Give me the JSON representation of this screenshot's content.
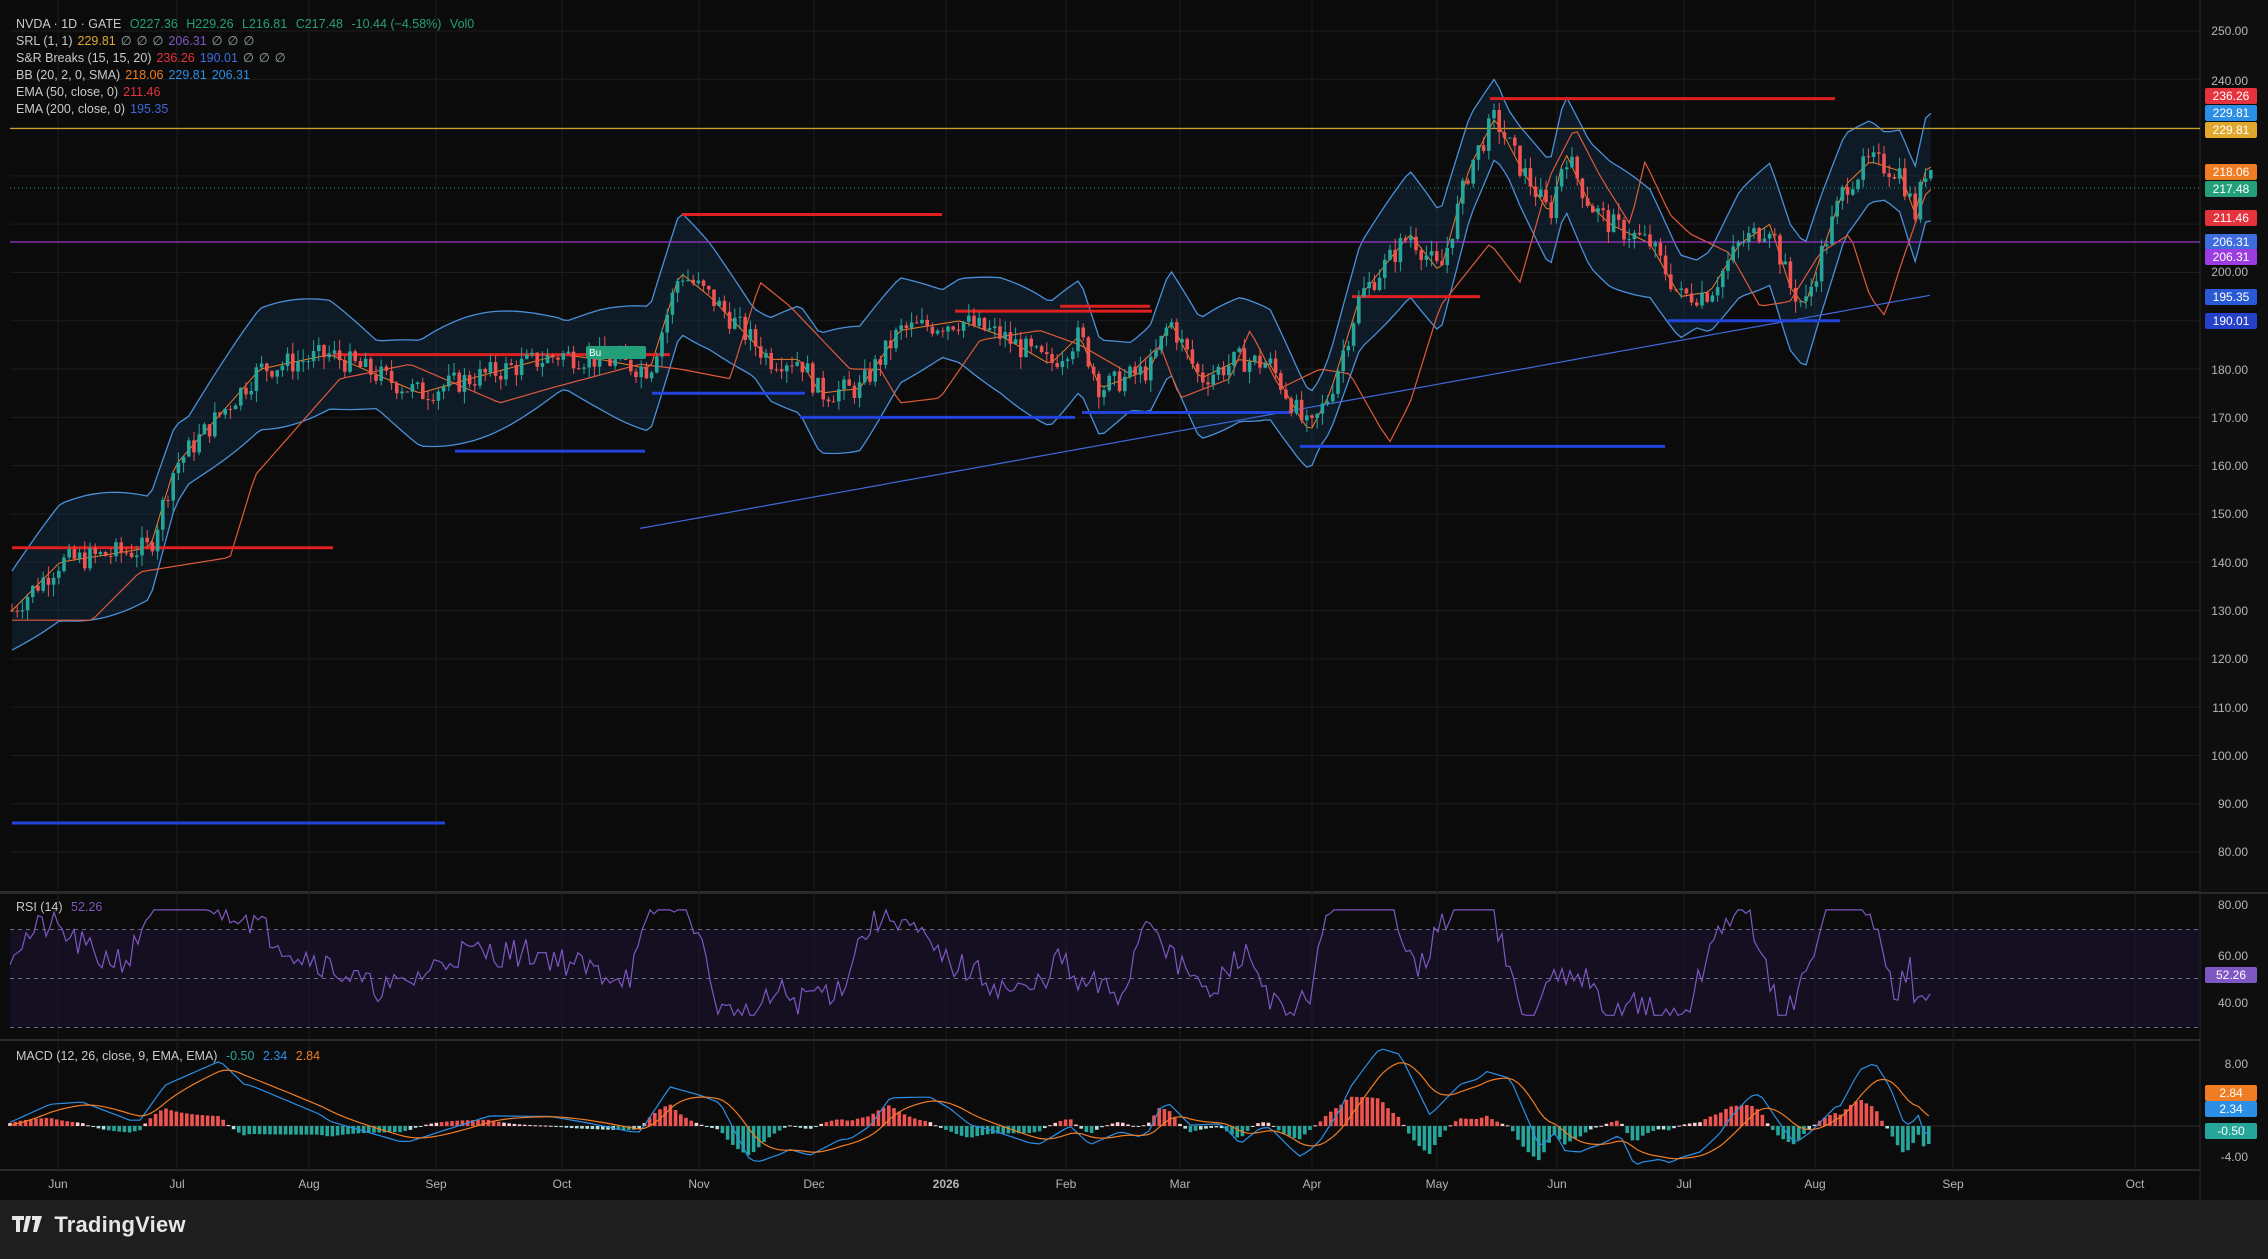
{
  "symbol_line": {
    "symbol": "NVDA · 1D · GATE",
    "open": "O227.36",
    "high": "H229.26",
    "low": "L216.81",
    "close": "C217.48",
    "change": "-10.44 (−4.58%)",
    "volume": "Vol0"
  },
  "indicators": [
    {
      "name": "SRL (1, 1)",
      "values": [
        "229.81",
        "∅",
        "∅",
        "∅",
        "206.31",
        "∅",
        "∅",
        "∅"
      ]
    },
    {
      "name": "S&R Breaks (15, 15, 20)",
      "values": [
        "236.26",
        "190.01",
        "∅",
        "∅",
        "∅"
      ]
    },
    {
      "name": "BB (20, 2, 0, SMA)",
      "values": [
        "218.06",
        "229.81",
        "206.31"
      ]
    },
    {
      "name": "EMA (50, close, 0)",
      "values": [
        "211.46"
      ]
    },
    {
      "name": "EMA (200, close, 0)",
      "values": [
        "195.35"
      ]
    }
  ],
  "rsi_legend": {
    "name": "RSI (14)",
    "value": "52.26"
  },
  "macd_legend": {
    "name": "MACD (12, 26, close, 9, EMA, EMA)",
    "values": [
      "-0.50",
      "2.34",
      "2.84"
    ]
  },
  "price_axis_labels": [
    "250.00",
    "240.00",
    "200.00",
    "190.00",
    "180.00",
    "170.00",
    "160.00",
    "150.00",
    "140.00",
    "130.00",
    "120.00",
    "110.00",
    "100.00",
    "90.00",
    "80.00"
  ],
  "price_tags": [
    {
      "label": "236.26",
      "color": "#e5323d"
    },
    {
      "label": "229.81",
      "color": "#2b8fe6"
    },
    {
      "label": "229.81",
      "color": "#e0a82e"
    },
    {
      "label": "218.06",
      "color": "#f07d23"
    },
    {
      "label": "217.48",
      "color": "#23a07a"
    },
    {
      "label": "211.46",
      "color": "#e5323d"
    },
    {
      "label": "206.31",
      "color": "#3e6de0"
    },
    {
      "label": "206.31",
      "color": "#9b3ce0"
    },
    {
      "label": "195.35",
      "color": "#2a59d6"
    },
    {
      "label": "190.01",
      "color": "#2540c9"
    }
  ],
  "rsi_axis_labels": [
    "80.00",
    "60.00",
    "40.00"
  ],
  "rsi_tag": {
    "label": "52.26",
    "color": "#7e57c2"
  },
  "macd_axis_labels": [
    "8.00",
    "-4.00"
  ],
  "macd_tags": [
    {
      "label": "2.84",
      "color": "#f07d23"
    },
    {
      "label": "2.34",
      "color": "#2b8fe6"
    },
    {
      "label": "-0.50",
      "color": "#26a69a"
    }
  ],
  "time_axis_labels": [
    "Jun",
    "Jul",
    "Aug",
    "Sep",
    "Oct",
    "Nov",
    "Dec",
    "2026",
    "Feb",
    "Mar",
    "Apr",
    "May",
    "Jun",
    "Jul",
    "Aug",
    "Sep",
    "Oct"
  ],
  "badge_label": "Bu",
  "brand": "TradingView",
  "colors": {
    "background": "#0b0b0b",
    "grid": "#1c1c1c",
    "up": "#26a69a",
    "down": "#ef5350",
    "bb": "#4a90d9",
    "ema50": "#e05a3a",
    "ema200": "#3f68d8",
    "resistance": "#e02020",
    "support": "#2244dd",
    "srl_gold": "#c8a030",
    "srl_purple": "#9a34c8",
    "rsi": "#7e57c2",
    "macd": "#2b8fe6",
    "signal": "#f07d23"
  }
}
